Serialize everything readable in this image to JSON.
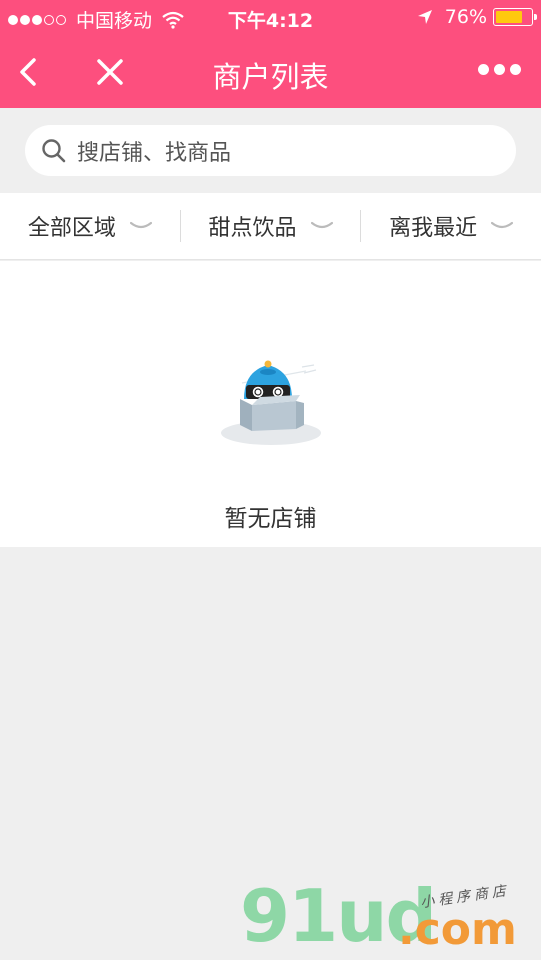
{
  "status_bar": {
    "carrier": "中国移动",
    "time": "下午4:12",
    "battery_percent": "76%",
    "battery_level": 0.76,
    "signal_bars_filled": 3,
    "signal_bars_total": 5
  },
  "nav": {
    "title": "商户列表",
    "back_icon": "chevron-left-icon",
    "close_icon": "close-icon",
    "more_icon": "more-dots-icon",
    "accent_color": "#fd4f7e"
  },
  "search": {
    "placeholder": "搜店铺、找商品",
    "icon": "search-icon"
  },
  "filters": [
    {
      "label": "全部区域",
      "icon": "chevron-down-icon"
    },
    {
      "label": "甜点饮品",
      "icon": "chevron-down-icon"
    },
    {
      "label": "离我最近",
      "icon": "chevron-down-icon"
    }
  ],
  "empty_state": {
    "illustration": "empty-box-mascot-icon",
    "message": "暂无店铺"
  },
  "watermark": {
    "brand": "91ud",
    "domain": ".com",
    "tagline": "小程序商店"
  }
}
